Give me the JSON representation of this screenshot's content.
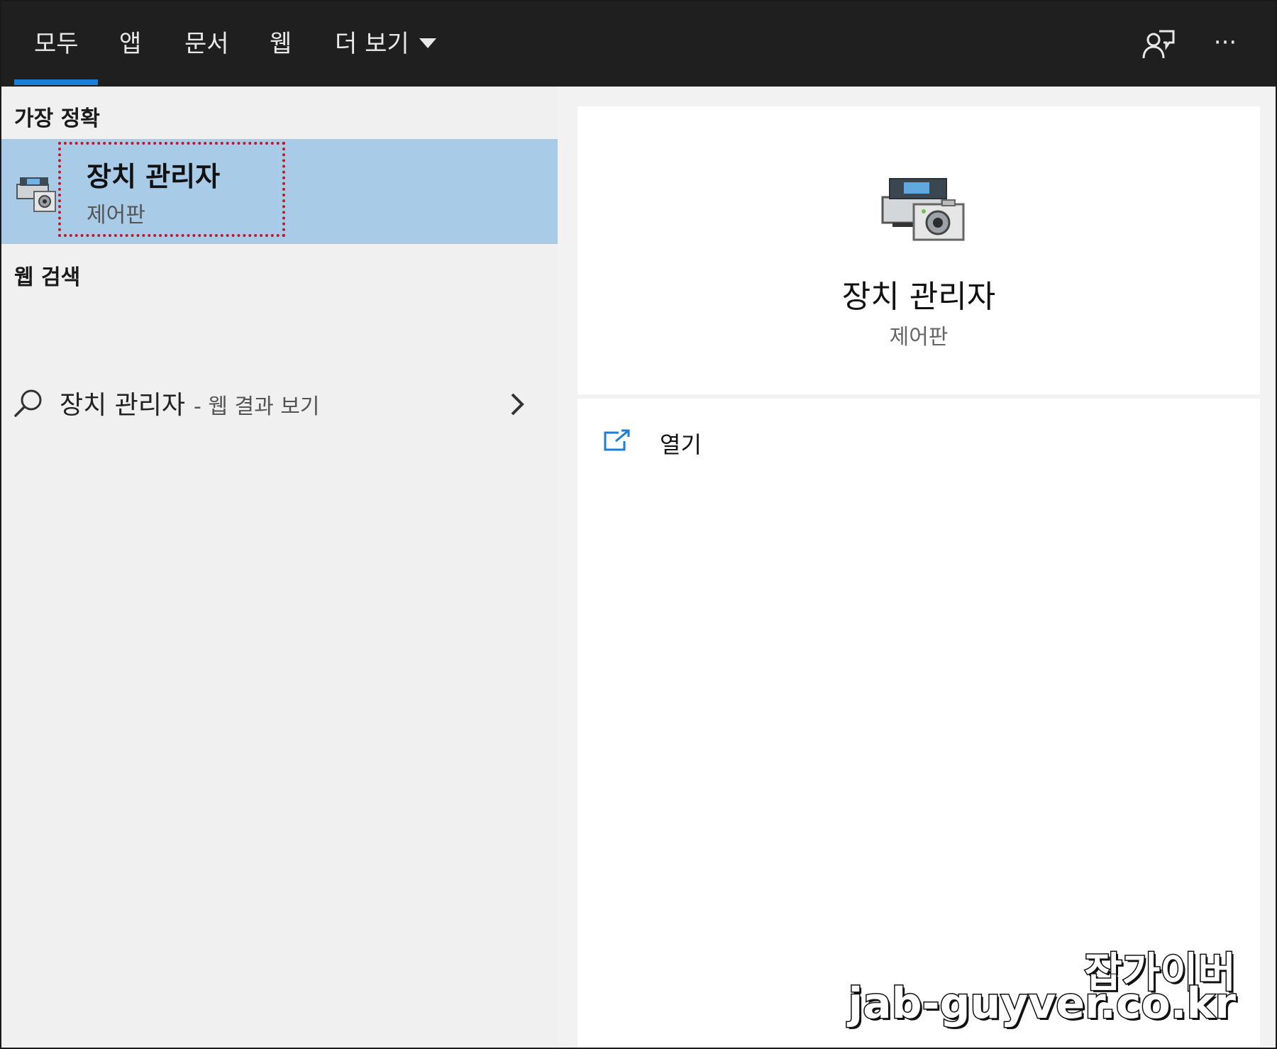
{
  "tabs": [
    {
      "label": "모두",
      "active": true
    },
    {
      "label": "앱"
    },
    {
      "label": "문서"
    },
    {
      "label": "웹"
    },
    {
      "label": "더 보기"
    }
  ],
  "top_icons": [
    "feedback-icon",
    "more-options-icon"
  ],
  "more_glyph": "···",
  "colors": {
    "topbar": "#1f1f1f",
    "accent": "#1a7fd6",
    "selected": "#a8cbe8",
    "highlight_border": "#c0172c"
  },
  "best_match": {
    "section_label": "가장 정확",
    "title": "장치 관리자",
    "subtitle": "제어판",
    "icon": "device-manager-icon"
  },
  "web_search": {
    "section_label": "웹 검색",
    "query": "장치 관리자",
    "suffix": "- 웹 결과 보기",
    "icon": "search-icon"
  },
  "preview": {
    "title": "장치 관리자",
    "subtitle": "제어판",
    "icon": "device-manager-icon",
    "actions": [
      {
        "label": "열기",
        "icon": "open-icon"
      }
    ]
  },
  "watermark": {
    "line1": "잡가이버",
    "line2": "jab-guyver.co.kr"
  }
}
